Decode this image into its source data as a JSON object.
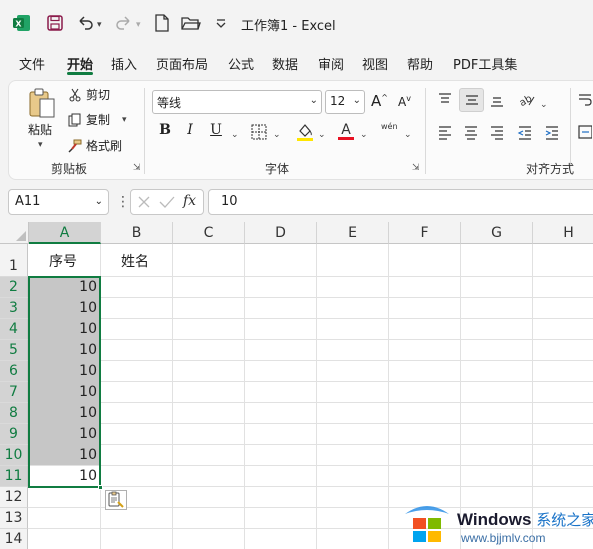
{
  "title": {
    "text": "工作簿1  -  Excel"
  },
  "tabs": [
    "文件",
    "开始",
    "插入",
    "页面布局",
    "公式",
    "数据",
    "审阅",
    "视图",
    "帮助",
    "PDF工具集"
  ],
  "ribbon": {
    "clipboard": {
      "paste": "粘贴",
      "cut": "剪切",
      "copy": "复制",
      "format_painter": "格式刷",
      "group_label": "剪贴板"
    },
    "font": {
      "font_name": "等线",
      "font_size": "12",
      "group_label": "字体",
      "bold": "B",
      "italic": "I",
      "underline": "U",
      "grow": "A",
      "shrink": "A",
      "phonetic": "wén"
    },
    "alignment": {
      "group_label": "对齐方式"
    }
  },
  "formula_bar": {
    "name_box": "A11",
    "fx": "fx",
    "value": "10"
  },
  "grid": {
    "columns": [
      "A",
      "B",
      "C",
      "D",
      "E",
      "F",
      "G",
      "H"
    ],
    "rows": [
      "1",
      "2",
      "3",
      "4",
      "5",
      "6",
      "7",
      "8",
      "9",
      "10",
      "11",
      "12",
      "13",
      "14"
    ],
    "a_header": "序号",
    "b_header": "姓名",
    "a_values": [
      "10",
      "10",
      "10",
      "10",
      "10",
      "10",
      "10",
      "10",
      "10",
      "10"
    ]
  },
  "watermark": {
    "brand": "Windows",
    "site": "系统之家",
    "url": "www.bjjmlv.com"
  },
  "colors": {
    "accent": "#107c41",
    "selection": "#c6c6c6"
  }
}
